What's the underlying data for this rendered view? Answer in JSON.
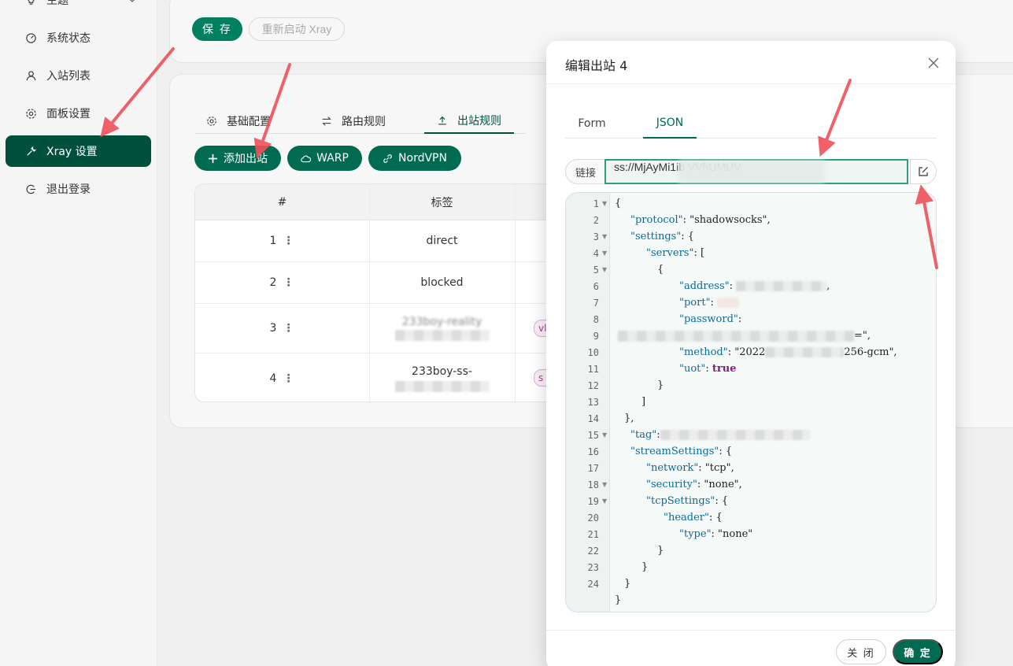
{
  "sidebar": {
    "items": [
      {
        "label": "主题",
        "icon": "bulb-icon"
      },
      {
        "label": "系统状态",
        "icon": "dashboard-icon"
      },
      {
        "label": "入站列表",
        "icon": "user-icon"
      },
      {
        "label": "面板设置",
        "icon": "gear-icon"
      },
      {
        "label": "Xray 设置",
        "icon": "tool-icon",
        "active": true
      },
      {
        "label": "退出登录",
        "icon": "logout-icon"
      }
    ]
  },
  "toolbar": {
    "save_label": "保 存",
    "restart_label": "重新启动 Xray"
  },
  "tabs": [
    {
      "label": "基础配置",
      "icon": "gear-icon"
    },
    {
      "label": "路由规则",
      "icon": "swap-icon"
    },
    {
      "label": "出站规则",
      "icon": "upload-icon",
      "active": true
    }
  ],
  "actions": {
    "add_outbound": "添加出站",
    "warp": "WARP",
    "nordvpn": "NordVPN"
  },
  "table": {
    "headers": [
      "#",
      "标签"
    ],
    "rows": [
      {
        "num": "1",
        "tag": "direct"
      },
      {
        "num": "2",
        "tag": "blocked"
      },
      {
        "num": "3",
        "tag": "233boy-reality",
        "chip": "vl"
      },
      {
        "num": "4",
        "tag": "233boy-ss-",
        "chip": "s"
      }
    ]
  },
  "modal": {
    "title": "编辑出站 4",
    "tabs": [
      "Form",
      "JSON"
    ],
    "active_tab": "JSON",
    "link_label": "链接",
    "link_value": "ss://MjAyMi1ib                                  VVhUMUV",
    "close_label": "关 闭",
    "ok_label": "确 定"
  },
  "editor": {
    "lines": [
      "1",
      "2",
      "3",
      "4",
      "5",
      "6",
      "7",
      "8",
      "9",
      "10",
      "11",
      "12",
      "13",
      "14",
      "15",
      "16",
      "17",
      "18",
      "19",
      "20",
      "21",
      "22",
      "23",
      "24"
    ],
    "code": {
      "l1": "{",
      "l2a": "\"protocol\"",
      "l2b": ": \"shadowsocks\",",
      "l3a": "\"settings\"",
      "l3b": ": {",
      "l4a": "\"servers\"",
      "l4b": ": [",
      "l5": "{",
      "l6a": "\"address\"",
      "l6b": ":",
      "l7a": "\"port\"",
      "l7b": ":",
      "l8a": "\"password\"",
      "l8b": ":",
      "l8c": "=\",",
      "l9a": "\"method\"",
      "l9b": ": \"2022",
      "l9c": "256-gcm\",",
      "l10a": "\"uot\"",
      "l10b": ": ",
      "l10c": "true",
      "l11": "}",
      "l12": "]",
      "l13": "},",
      "l14a": "\"tag\"",
      "l14b": ":",
      "l15a": "\"streamSettings\"",
      "l15b": ": {",
      "l16a": "\"network\"",
      "l16b": ": \"tcp\",",
      "l17a": "\"security\"",
      "l17b": ": \"none\",",
      "l18a": "\"tcpSettings\"",
      "l18b": ": {",
      "l19a": "\"header\"",
      "l19b": ": {",
      "l20a": "\"type\"",
      "l20b": ": \"none\"",
      "l21": "}",
      "l22": "}",
      "l23": "}",
      "l24": "}"
    }
  },
  "colors": {
    "accent": "#006b50",
    "sidebar_active": "#00513c",
    "arrow": "#f0505a"
  }
}
